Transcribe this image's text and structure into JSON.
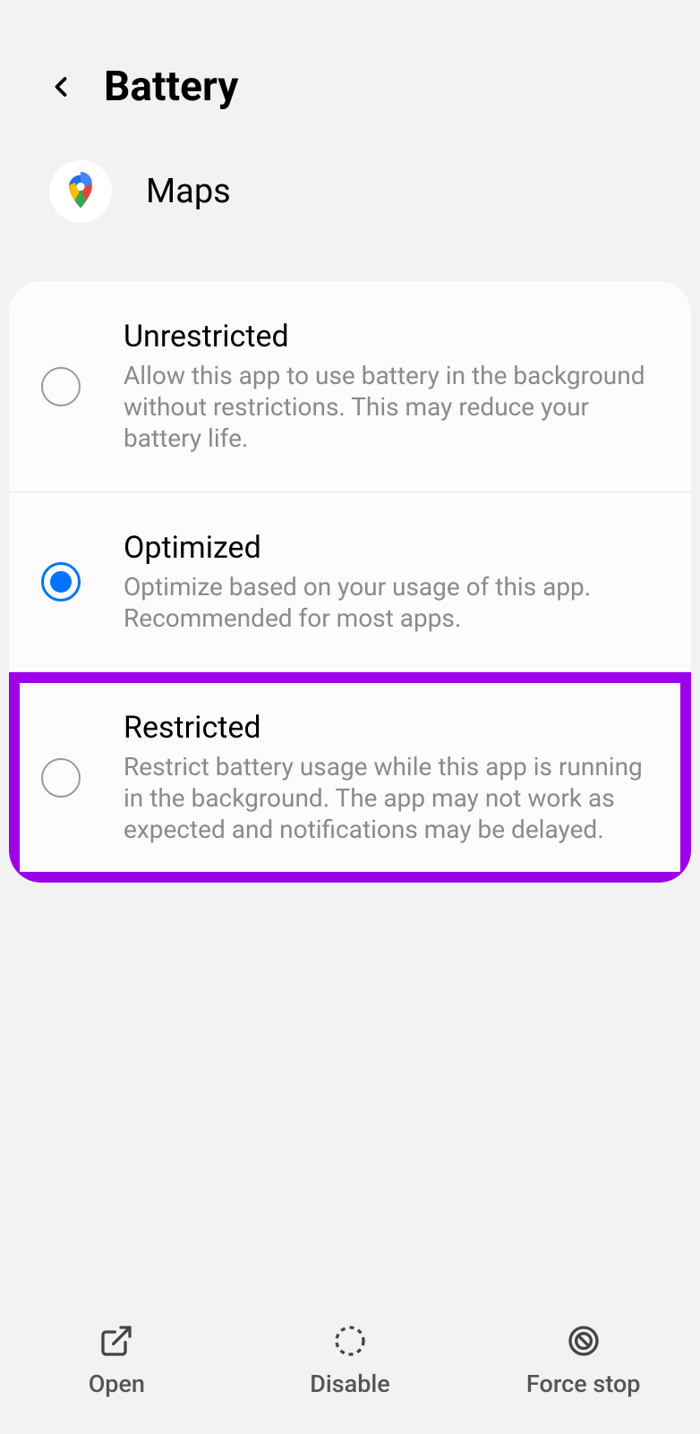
{
  "header": {
    "title": "Battery"
  },
  "app": {
    "name": "Maps"
  },
  "options": [
    {
      "title": "Unrestricted",
      "description": "Allow this app to use battery in the background without restrictions. This may reduce your battery life.",
      "selected": false,
      "highlighted": false
    },
    {
      "title": "Optimized",
      "description": "Optimize based on your usage of this app. Recommended for most apps.",
      "selected": true,
      "highlighted": false
    },
    {
      "title": "Restricted",
      "description": "Restrict battery usage while this app is running in the background. The app may not work as expected and notifications may be delayed.",
      "selected": false,
      "highlighted": true
    }
  ],
  "bottomActions": {
    "open": "Open",
    "disable": "Disable",
    "forceStop": "Force stop"
  }
}
